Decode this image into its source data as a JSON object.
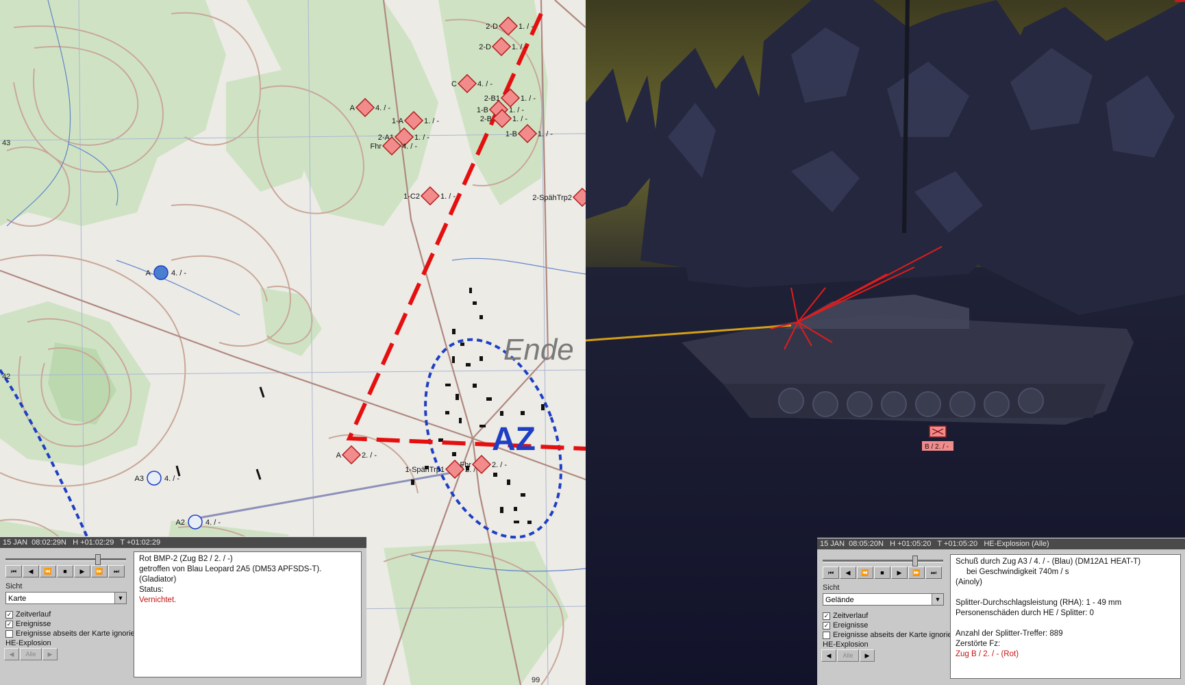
{
  "map": {
    "town_label": "Ende",
    "objective_label": "AZ",
    "grid_labels": [
      "43",
      "42",
      "99"
    ],
    "blue_units": [
      {
        "label": "A",
        "status": "4. / -"
      },
      {
        "label": "A3",
        "status": "4. / -"
      },
      {
        "label": "A2",
        "status": "4. / -"
      }
    ],
    "red_units": [
      {
        "label": "2-D",
        "status": "1. / -"
      },
      {
        "label": "2-D",
        "status": "1. / -"
      },
      {
        "label": "C",
        "status": "4. / -"
      },
      {
        "label": "A",
        "status": "4. / -"
      },
      {
        "label": "2-B1",
        "status": "1. / -"
      },
      {
        "label": "1-B",
        "status": "1. / -"
      },
      {
        "label": "1-A",
        "status": "1. / -"
      },
      {
        "label": "2-A1",
        "status": "1. / -"
      },
      {
        "label": "Fhr",
        "status": "4. / -"
      },
      {
        "label": "2-B",
        "status": "1. / -"
      },
      {
        "label": "1-B",
        "status": "1. / -"
      },
      {
        "label": "1-C2",
        "status": "1. / -"
      },
      {
        "label": "2-SpähTrp2",
        "status": ""
      },
      {
        "label": "A",
        "status": "2. / -"
      },
      {
        "label": "1-SpähTrp1",
        "status": "2. / -"
      },
      {
        "label": "Fhr",
        "status": "2. / -"
      }
    ]
  },
  "left_panel": {
    "header": "15 JAN  08:02:29N   H +01:02:29   T +01:02:29",
    "sicht_label": "Sicht",
    "sicht_value": "Karte",
    "checkboxes": [
      {
        "label": "Zeitverlauf",
        "checked": true
      },
      {
        "label": "Ereignisse",
        "checked": true
      },
      {
        "label": "Ereignisse abseits der Karte ignorieren",
        "checked": false
      }
    ],
    "group_label": "HE-Explosion",
    "group_button": "Alle",
    "info_lines": [
      {
        "text": "Rot BMP-2 (Zug B2 / 2. / -)",
        "color": "#111111"
      },
      {
        "text": "getroffen von Blau Leopard 2A5 (DM53 APFSDS-T).",
        "color": "#111111"
      },
      {
        "text": "(Gladiator)",
        "color": "#111111"
      },
      {
        "text": "Status:",
        "color": "#111111"
      },
      {
        "text": "Vernichtet.",
        "color": "#c41212"
      }
    ]
  },
  "scene": {
    "vehicle_label": "B / 2. / -"
  },
  "right_panel": {
    "header": "15 JAN  08:05:20N   H +01:05:20   T +01:05:20   HE-Explosion (Alle)",
    "sicht_label": "Sicht",
    "sicht_value": "Gelände",
    "checkboxes": [
      {
        "label": "Zeitverlauf",
        "checked": true
      },
      {
        "label": "Ereignisse",
        "checked": true
      },
      {
        "label": "Ereignisse abseits der Karte ignorieren",
        "checked": false
      }
    ],
    "group_label": "HE-Explosion",
    "group_button": "Alle",
    "info_lines": [
      {
        "text": "Schuß durch Zug A3 / 4. / - (Blau) (DM12A1 HEAT-T)",
        "color": "#111111"
      },
      {
        "text": "     bei Geschwindigkeit 740m / s",
        "color": "#111111"
      },
      {
        "text": "(Ainoly)",
        "color": "#111111"
      },
      {
        "text": "",
        "color": "#111111"
      },
      {
        "text": "Splitter-Durchschlagsleistung (RHA): 1 - 49 mm",
        "color": "#111111"
      },
      {
        "text": "Personenschäden durch HE / Splitter: 0",
        "color": "#111111"
      },
      {
        "text": "",
        "color": "#111111"
      },
      {
        "text": "Anzahl der Splitter-Treffer: 889",
        "color": "#111111"
      },
      {
        "text": "Zerstörte Fz:",
        "color": "#111111"
      },
      {
        "text": "Zug B / 2. / - (Rot)",
        "color": "#c41212"
      }
    ]
  },
  "controls": {
    "buttons": [
      "⏮",
      "◀",
      "⏪",
      "■",
      "▶",
      "⏩",
      "⏭"
    ]
  }
}
